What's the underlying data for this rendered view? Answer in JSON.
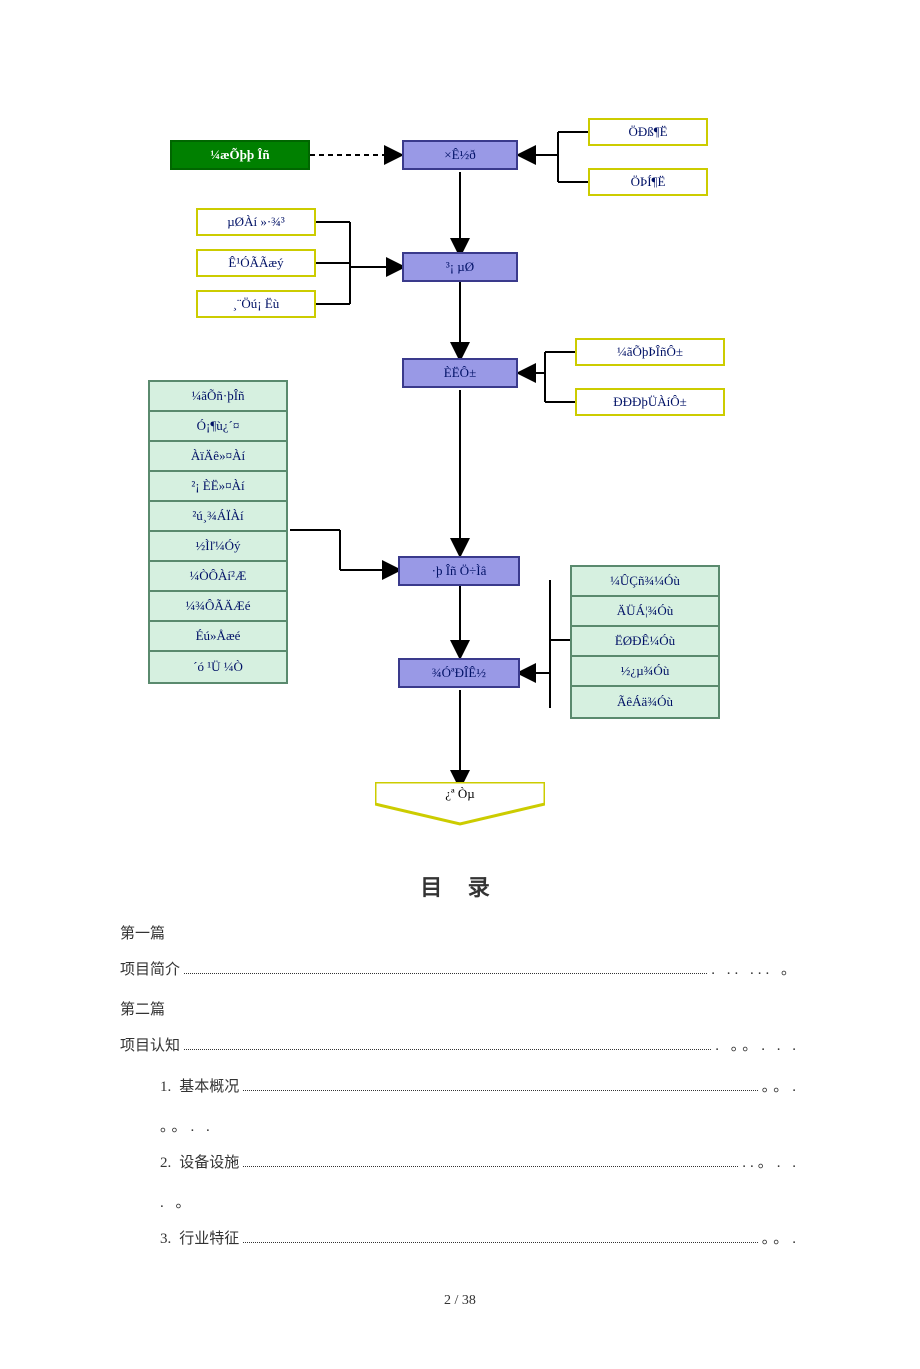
{
  "diagram": {
    "start": "¼æÕþþ Îñ",
    "step1": "×Ê½ð",
    "step2": "³¡ µØ",
    "step3": "ÈËÔ±",
    "step4": "·þ Îñ Ö÷Ìâ",
    "step5": "¾­ÓªÐÎÊ½",
    "end": "¿ª   Òµ",
    "right1": [
      "ÖÐß¶Ë",
      "ÖÞÍ¶Ë"
    ],
    "left2": [
      "µØÀí »·¾³",
      "Ê¹ÓÃÃæý",
      "¸¨Öú¡ Ëù"
    ],
    "right3": [
      "¼ãÕþÞÎñÔ±",
      "ÐÐÐþÜÀíÔ±"
    ],
    "list4": [
      "¼ãÕñ·þÎñ",
      "Ó¡¶ù¿´¤",
      "ÀïÄê»¤Àí",
      "²¡ ÈË»¤Àí",
      "²ú¸¾ÁÏÀí",
      "½Ìľ¼Óý",
      "¼ÒÔÀí²Æ",
      "¼¾ÔÃÄÆé",
      "Éú»Åæé",
      "´ó ¹Ü ¼Ò"
    ],
    "right5": [
      "¼ÛÇñ¾¼Óù",
      "ÄÜÁ¦¾­Óù",
      "ËØÐÊ¼Óù",
      "½¿µ¾­Óù",
      "ÃêÁä¾­Óù"
    ]
  },
  "toc": {
    "title": "目  录",
    "s1": "第一篇",
    "l1": {
      "label": "项目简介",
      "tail": ". .. ... 。"
    },
    "s2": "第二篇",
    "l2": {
      "label": "项目认知",
      "tail": ". 。。. . ."
    },
    "i1": {
      "num": "1.",
      "label": "基本概况",
      "tail": "。。."
    },
    "n1": "。。.  .",
    "i2": {
      "num": "2.",
      "label": "设备设施",
      "tail": "..。. ."
    },
    "n2": ". 。",
    "i3": {
      "num": "3.",
      "label": "行业特征",
      "tail": "。。."
    }
  },
  "pagenum": "2 / 38"
}
